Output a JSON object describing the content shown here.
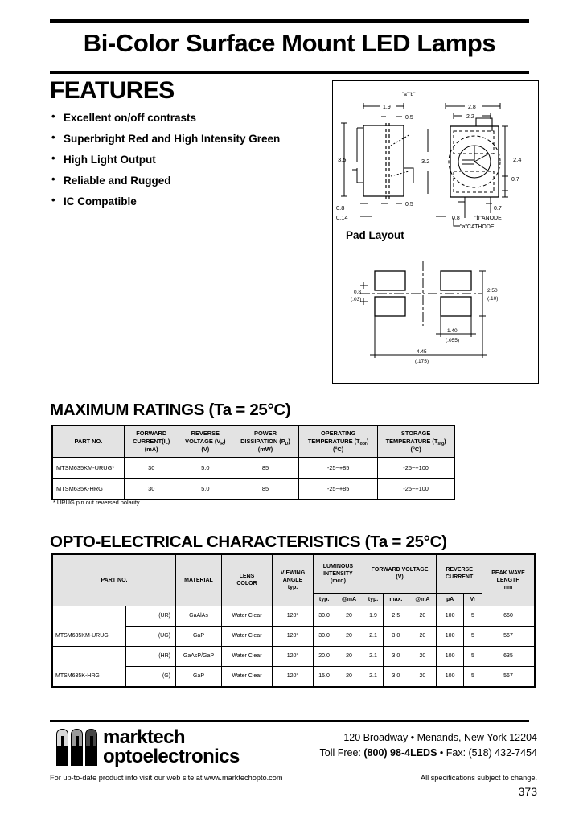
{
  "document": {
    "title": "Bi-Color Surface Mount LED Lamps",
    "page_number": "373"
  },
  "features": {
    "heading": "FEATURES",
    "bullet_glyph": "•",
    "items": [
      "Excellent on/off contrasts",
      "Superbright Red and High Intensity Green",
      "High Light Output",
      "Reliable and Rugged",
      "IC Compatible"
    ]
  },
  "drawing": {
    "pad_layout_label": "Pad Layout",
    "package_dims": {
      "height_left": "3.5",
      "width_top": "1.9",
      "notch_top": "0.5",
      "notch_bottom": "0.5",
      "bottom_left_a": "0.8",
      "bottom_left_b": "0.14",
      "center_height": "3.2",
      "top_label": "\"a\"\"b\"",
      "width_outer": "2.8",
      "width_inner": "2.2",
      "right_dim_a": "2.4",
      "right_dim_b": "0.7",
      "right_dim_c": "0.7",
      "bottom_dim": "0.8",
      "anode_label": "\"b\"ANODE",
      "cathode_label": "\"a\"CATHODE"
    },
    "pad_dims": {
      "gap_mm": "0.8",
      "gap_in": "(.03)",
      "height_mm": "2.50",
      "height_in": "(.10)",
      "pad_w_mm": "1.40",
      "pad_w_in": "(.055)",
      "total_mm": "4.45",
      "total_in": "(.175)"
    }
  },
  "maximum_ratings": {
    "heading": "MAXIMUM RATINGS (Ta = 25°C)",
    "columns": [
      {
        "l1": "PART NO.",
        "l2": "",
        "l3": ""
      },
      {
        "l1": "FORWARD",
        "l2": "CURRENT(I",
        "sub": "F",
        "l2b": ")",
        "l3": "(mA)"
      },
      {
        "l1": "REVERSE",
        "l2": "VOLTAGE (V",
        "sub": "R",
        "l2b": ")",
        "l3": "(V)"
      },
      {
        "l1": "POWER",
        "l2": "DISSIPATION (P",
        "sub": "D",
        "l2b": ")",
        "l3": "(mW)"
      },
      {
        "l1": "OPERATING",
        "l2": "TEMPERATURE (T",
        "sub": "opr",
        "l2b": ")",
        "l3": "(°C)"
      },
      {
        "l1": "STORAGE",
        "l2": "TEMPERATURE (T",
        "sub": "stg",
        "l2b": ")",
        "l3": "(°C)"
      }
    ],
    "rows": [
      {
        "part_no": "MTSM635KM-URUG*",
        "forward_current": "30",
        "reverse_voltage": "5.0",
        "power_dissipation": "85",
        "operating_temp": "-25~+85",
        "storage_temp": "-25~+100"
      },
      {
        "part_no": "MTSM635K-HRG",
        "forward_current": "30",
        "reverse_voltage": "5.0",
        "power_dissipation": "85",
        "operating_temp": "-25~+85",
        "storage_temp": "-25~+100"
      }
    ],
    "footnote": "* URUG pin out reversed polarity"
  },
  "opto_electrical": {
    "heading": "OPTO-ELECTRICAL  CHARACTERISTICS (Ta = 25°C)",
    "headers": {
      "part_no": "PART NO.",
      "material": "MATERIAL",
      "lens_color_l1": "LENS",
      "lens_color_l2": "COLOR",
      "viewing_angle_l1": "VIEWING",
      "viewing_angle_l2": "ANGLE",
      "viewing_angle_l3": "typ.",
      "luminous_l1": "LUMINOUS",
      "luminous_l2": "INTENSITY",
      "luminous_l3": "(mcd)",
      "forward_voltage_l1": "FORWARD VOLTAGE",
      "forward_voltage_l2": "(V)",
      "reverse_current_l1": "REVERSE",
      "reverse_current_l2": "CURRENT",
      "peak_wave_l1": "PEAK WAVE",
      "peak_wave_l2": "LENGTH",
      "sub_lum_typ": "typ.",
      "sub_lum_ma": "@mA",
      "sub_vf_typ": "typ.",
      "sub_vf_max": "max.",
      "sub_vf_ma": "@mA",
      "sub_ir_ua": "µA",
      "sub_ir_vr": "Vr",
      "sub_pw_nm": "nm"
    },
    "groups": [
      {
        "part_no": "MTSM635KM-URUG",
        "rows": [
          {
            "bin": "(UR)",
            "material": "GaAlAs",
            "lens_color": "Water Clear",
            "viewing_angle": "120°",
            "lum_typ": "30.0",
            "lum_ma": "20",
            "vf_typ": "1.9",
            "vf_max": "2.5",
            "vf_ma": "20",
            "ir_ua": "100",
            "ir_vr": "5",
            "peak_nm": "660"
          },
          {
            "bin": "(UG)",
            "material": "GaP",
            "lens_color": "Water Clear",
            "viewing_angle": "120°",
            "lum_typ": "30.0",
            "lum_ma": "20",
            "vf_typ": "2.1",
            "vf_max": "3.0",
            "vf_ma": "20",
            "ir_ua": "100",
            "ir_vr": "5",
            "peak_nm": "567"
          }
        ]
      },
      {
        "part_no": "MTSM635K-HRG",
        "rows": [
          {
            "bin": "(HR)",
            "material": "GaAsP/GaP",
            "lens_color": "Water Clear",
            "viewing_angle": "120°",
            "lum_typ": "20.0",
            "lum_ma": "20",
            "vf_typ": "2.1",
            "vf_max": "3.0",
            "vf_ma": "20",
            "ir_ua": "100",
            "ir_vr": "5",
            "peak_nm": "635"
          },
          {
            "bin": "(G)",
            "material": "GaP",
            "lens_color": "Water Clear",
            "viewing_angle": "120°",
            "lum_typ": "15.0",
            "lum_ma": "20",
            "vf_typ": "2.1",
            "vf_max": "3.0",
            "vf_ma": "20",
            "ir_ua": "100",
            "ir_vr": "5",
            "peak_nm": "567"
          }
        ]
      }
    ]
  },
  "footer": {
    "company_line1": "marktech",
    "company_line2": "optoelectronics",
    "address": "120 Broadway • Menands, New York 12204",
    "toll_prefix": "Toll Free: ",
    "toll_number": "(800) 98-4LEDS",
    "fax": " • Fax: (518) 432-7454",
    "web_note": "For up-to-date product info visit our web site at www.marktechopto.com",
    "spec_note": "All specifications subject to change."
  }
}
